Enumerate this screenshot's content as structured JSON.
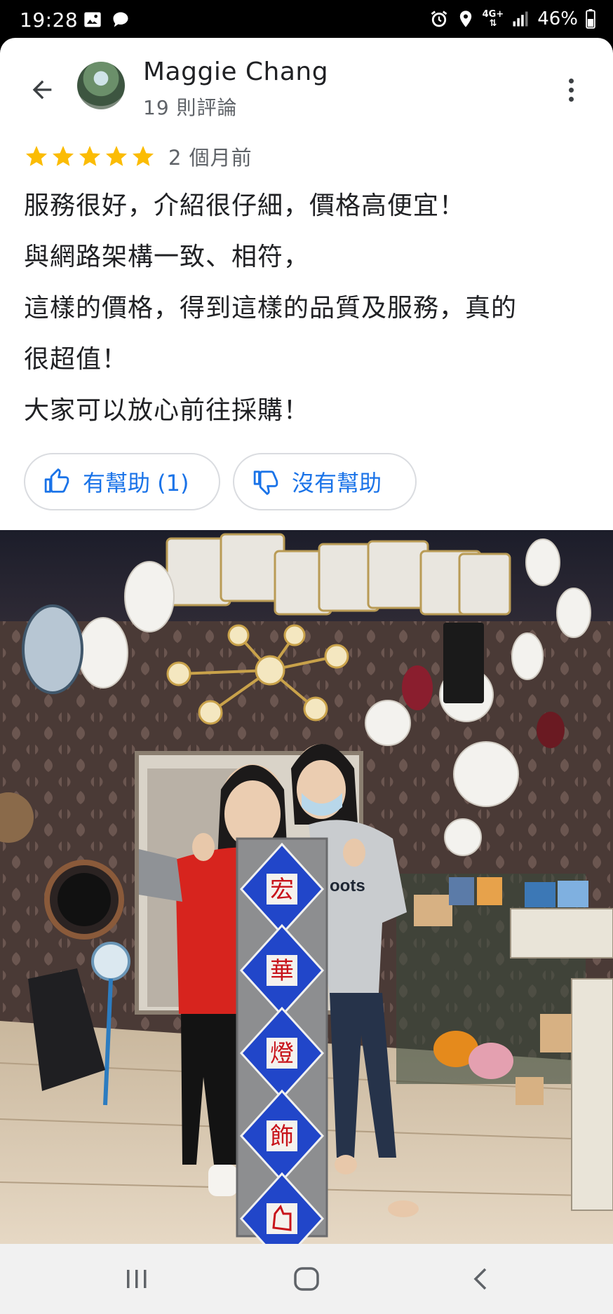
{
  "status_bar": {
    "time": "19:28",
    "left_icons": [
      "image-icon",
      "chat-bubble-icon"
    ],
    "right_icons": [
      "alarm-icon",
      "location-icon",
      "network-4g-icon",
      "signal-icon",
      "battery-icon"
    ],
    "network_label_top": "4G+",
    "battery": "46%"
  },
  "reviewer": {
    "name": "Maggie Chang",
    "review_count": "19 則評論"
  },
  "review": {
    "stars": 5,
    "time_ago": "2 個月前",
    "lines": [
      "服務很好，介紹很仔細，價格高便宜！",
      "與網路架構一致、相符，",
      "這樣的價格，得到這樣的品質及服務，真的",
      "很超值！",
      "大家可以放心前往採購！"
    ]
  },
  "actions": {
    "helpful_label": "有幫助 (1)",
    "unhelpful_label": "沒有幫助"
  },
  "photo": {
    "sign_characters": [
      "宏",
      "華",
      "燈",
      "飾"
    ],
    "shirt_text": "oots"
  },
  "colors": {
    "accent": "#1a73e8",
    "star": "#fbbc04",
    "text_primary": "#202124",
    "text_secondary": "#5f6368"
  }
}
